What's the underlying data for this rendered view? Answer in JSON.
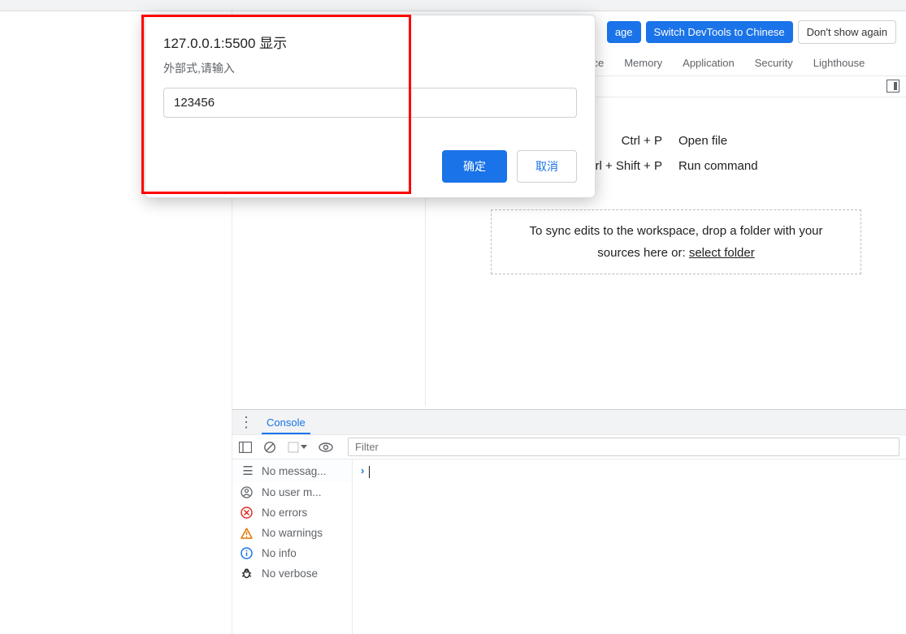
{
  "dialog": {
    "title": "127.0.0.1:5500 显示",
    "message": "外部式,请输入",
    "input_value": "123456",
    "ok_label": "确定",
    "cancel_label": "取消"
  },
  "banner": {
    "change_lang_partial": "age",
    "switch_devtools": "Switch DevTools to Chinese",
    "dont_show": "Don't show again"
  },
  "devtools_tabs": {
    "perf_partial": "ance",
    "memory": "Memory",
    "application": "Application",
    "security": "Security",
    "lighthouse": "Lighthouse"
  },
  "shortcuts": {
    "open_file_key": "Ctrl + P",
    "open_file_lbl": "Open file",
    "run_cmd_key_partial": "rl + Shift + P",
    "run_cmd_lbl": "Run command"
  },
  "dropzone": {
    "text_a": "To sync edits to the workspace, drop a folder with your sources here or: ",
    "link": "select folder"
  },
  "console": {
    "tab_label": "Console",
    "filter_placeholder": "Filter",
    "filters": {
      "messages": "No messag...",
      "user": "No user m...",
      "errors": "No errors",
      "warnings": "No warnings",
      "info": "No info",
      "verbose": "No verbose"
    }
  }
}
